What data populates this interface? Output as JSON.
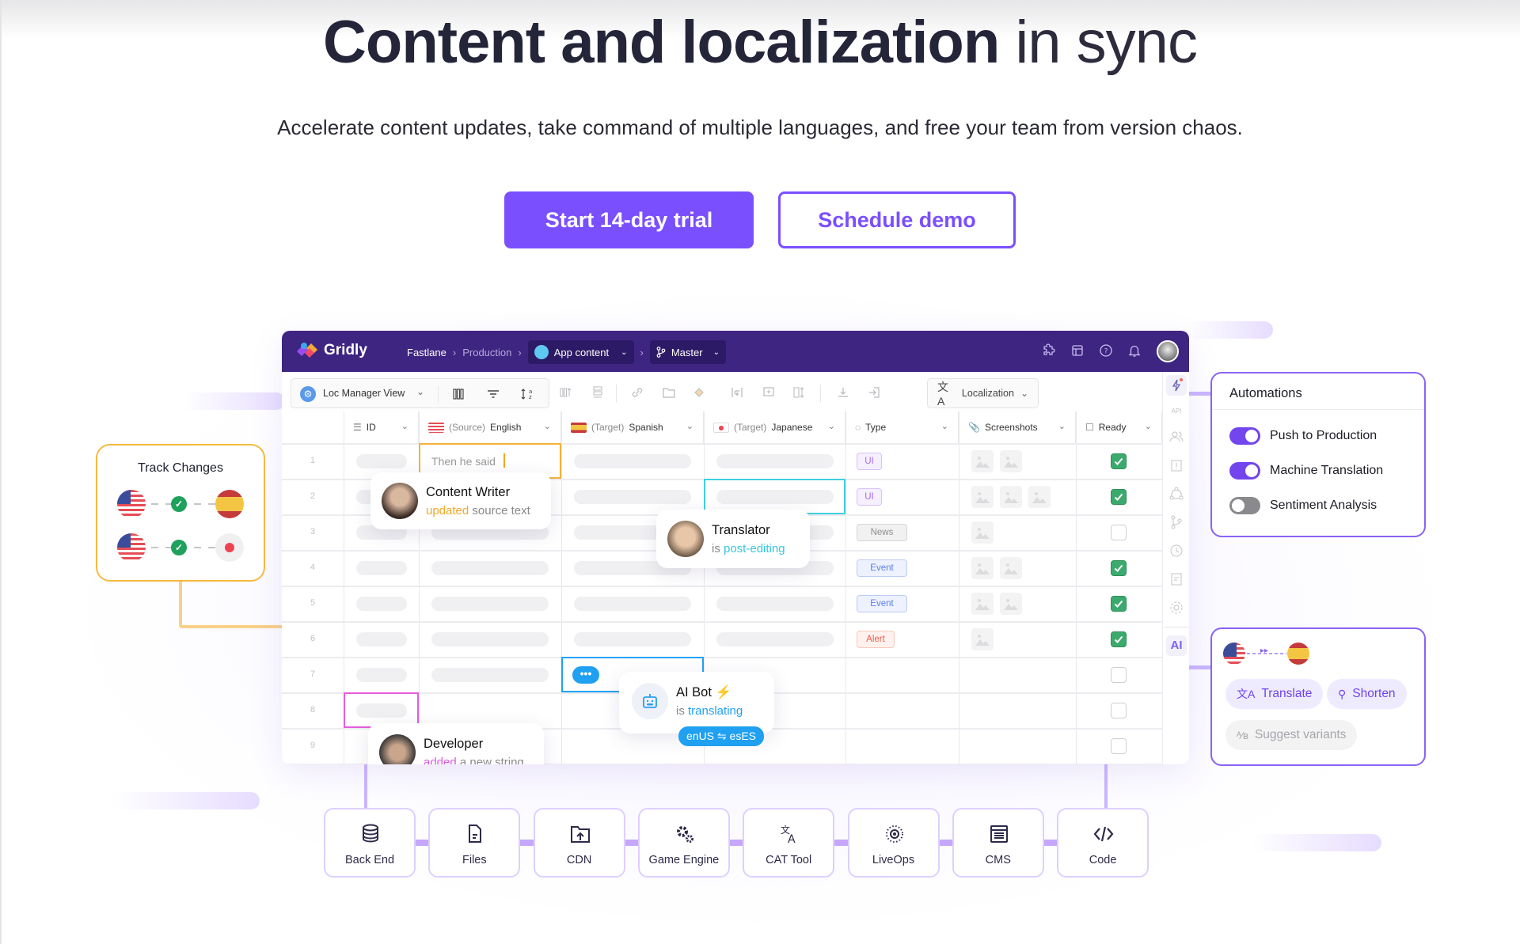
{
  "hero": {
    "title_bold": "Content and localization",
    "title_light": "in sync",
    "subtitle": "Accelerate content updates, take command of multiple languages, and free your team from version chaos.",
    "primary_cta": "Start 14-day trial",
    "secondary_cta": "Schedule demo"
  },
  "colors": {
    "brand": "#7a4ffe",
    "header": "#3e2581",
    "ready_green": "#3caa6e",
    "track_border": "#f6b93e"
  },
  "app": {
    "logo": "Gridly",
    "breadcrumb": {
      "workspace": "Fastlane",
      "folder": "Production",
      "grid": "App content",
      "branch": "Master"
    },
    "header_icons": [
      "puzzle-icon",
      "layout-icon",
      "help-icon",
      "bell-icon",
      "avatar"
    ],
    "toolbar": {
      "view": "Loc Manager View",
      "localization": "Localization"
    },
    "columns": [
      {
        "label": "ID",
        "prefix": ""
      },
      {
        "label": "English",
        "prefix": "(Source)"
      },
      {
        "label": "Spanish",
        "prefix": "(Target)"
      },
      {
        "label": "Japanese",
        "prefix": "(Target)"
      },
      {
        "label": "Type",
        "prefix": ""
      },
      {
        "label": "Screenshots",
        "prefix": ""
      },
      {
        "label": "Ready",
        "prefix": ""
      }
    ],
    "rows": [
      {
        "num": "1",
        "english": "Then he said",
        "type": "UI",
        "screenshots": 2,
        "ready": true
      },
      {
        "num": "2",
        "english": "",
        "type": "UI",
        "screenshots": 3,
        "ready": true
      },
      {
        "num": "3",
        "english": "",
        "type": "News",
        "screenshots": 1,
        "ready": false
      },
      {
        "num": "4",
        "english": "",
        "type": "Event",
        "screenshots": 2,
        "ready": true
      },
      {
        "num": "5",
        "english": "",
        "type": "Event",
        "screenshots": 2,
        "ready": true
      },
      {
        "num": "6",
        "english": "",
        "type": "Alert",
        "screenshots": 1,
        "ready": true
      },
      {
        "num": "7",
        "english": "",
        "type": "",
        "screenshots": 0,
        "ready": false
      },
      {
        "num": "8",
        "english": "",
        "type": "",
        "screenshots": 0,
        "ready": false
      },
      {
        "num": "9",
        "english": "",
        "type": "",
        "screenshots": 0,
        "ready": false
      }
    ],
    "sidebar_ai": "AI",
    "sidebar_api": "API"
  },
  "personas": {
    "writer": {
      "name": "Content Writer",
      "verb": "updated",
      "rest": " source text"
    },
    "translator": {
      "name": "Translator",
      "pre": "is ",
      "verb": "post-editing"
    },
    "ai_bot": {
      "name": "AI Bot",
      "pre": "is ",
      "verb": "translating",
      "badge": "enUS ⇋ esES"
    },
    "developer": {
      "name": "Developer",
      "verb": "added",
      "rest": " a new string"
    }
  },
  "track_changes": {
    "title": "Track Changes"
  },
  "automations": {
    "title": "Automations",
    "items": [
      {
        "label": "Push to Production",
        "on": true
      },
      {
        "label": "Machine Translation",
        "on": true
      },
      {
        "label": "Sentiment Analysis",
        "on": false
      }
    ]
  },
  "ai_actions": {
    "translate": "Translate",
    "shorten": "Shorten",
    "suggest": "Suggest variants"
  },
  "integrations": [
    "Back End",
    "Files",
    "CDN",
    "Game Engine",
    "CAT Tool",
    "LiveOps",
    "CMS",
    "Code"
  ]
}
